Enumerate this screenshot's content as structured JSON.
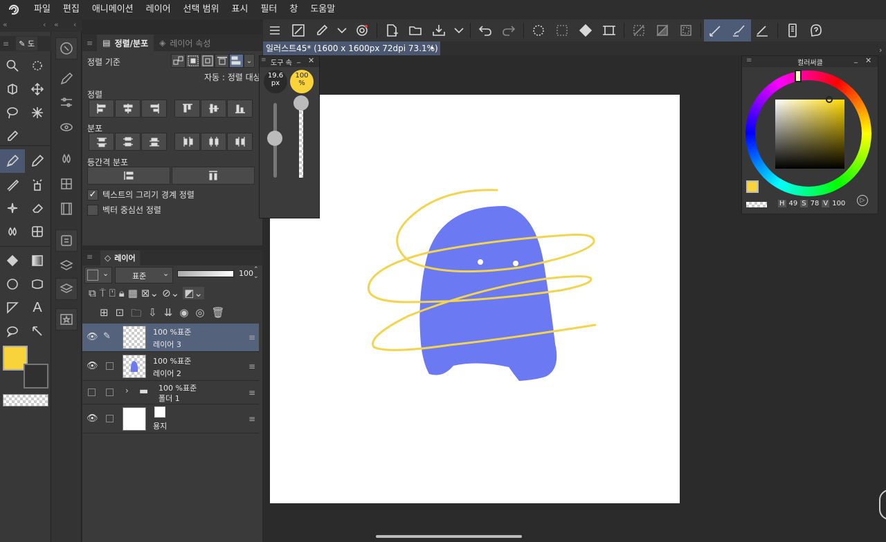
{
  "menu": [
    "파일",
    "편집",
    "애니메이션",
    "레이어",
    "선택 범위",
    "표시",
    "필터",
    "창",
    "도움말"
  ],
  "tool_panel_tab": "도",
  "align_panel": {
    "tab_active": "정렬/분포",
    "tab_inactive": "레이어 속성",
    "align_basis_label": "정렬 기준",
    "auto_target": "자동 : 정렬 대상",
    "align_label": "정렬",
    "distribute_label": "분포",
    "equal_spacing_label": "등간격 분포",
    "checkbox_text_bounds": "텍스트의 그리기 경계 정렬",
    "checkbox_vector_center": "벡터 중심선 정렬"
  },
  "layer_panel": {
    "title": "레이어",
    "blend_mode": "표준",
    "opacity": "100",
    "layers": [
      {
        "mode": "100 %표준",
        "name": "레이어 3",
        "selected": true
      },
      {
        "mode": "100 %표준",
        "name": "레이어 2",
        "selected": false
      },
      {
        "mode": "100 %표준",
        "name": "폴더 1",
        "selected": false
      },
      {
        "mode": "",
        "name": "용지",
        "selected": false
      }
    ]
  },
  "document": {
    "tab_title": "일러스트45* (1600 x 1600px 72dpi 73.1%)"
  },
  "tool_property": {
    "title": "도구 속",
    "brush_size": "19.6",
    "brush_unit": "px",
    "opacity": "100",
    "opacity_unit": "%"
  },
  "color_panel": {
    "title": "컬러써클",
    "h_label": "H",
    "h_value": "49",
    "s_label": "S",
    "s_value": "78",
    "v_label": "V",
    "v_value": "100"
  },
  "colors": {
    "main_color": "#f8d43a",
    "ghost": "#6b79f2",
    "swirl": "#f2d44e",
    "selection": "#4c5872"
  }
}
